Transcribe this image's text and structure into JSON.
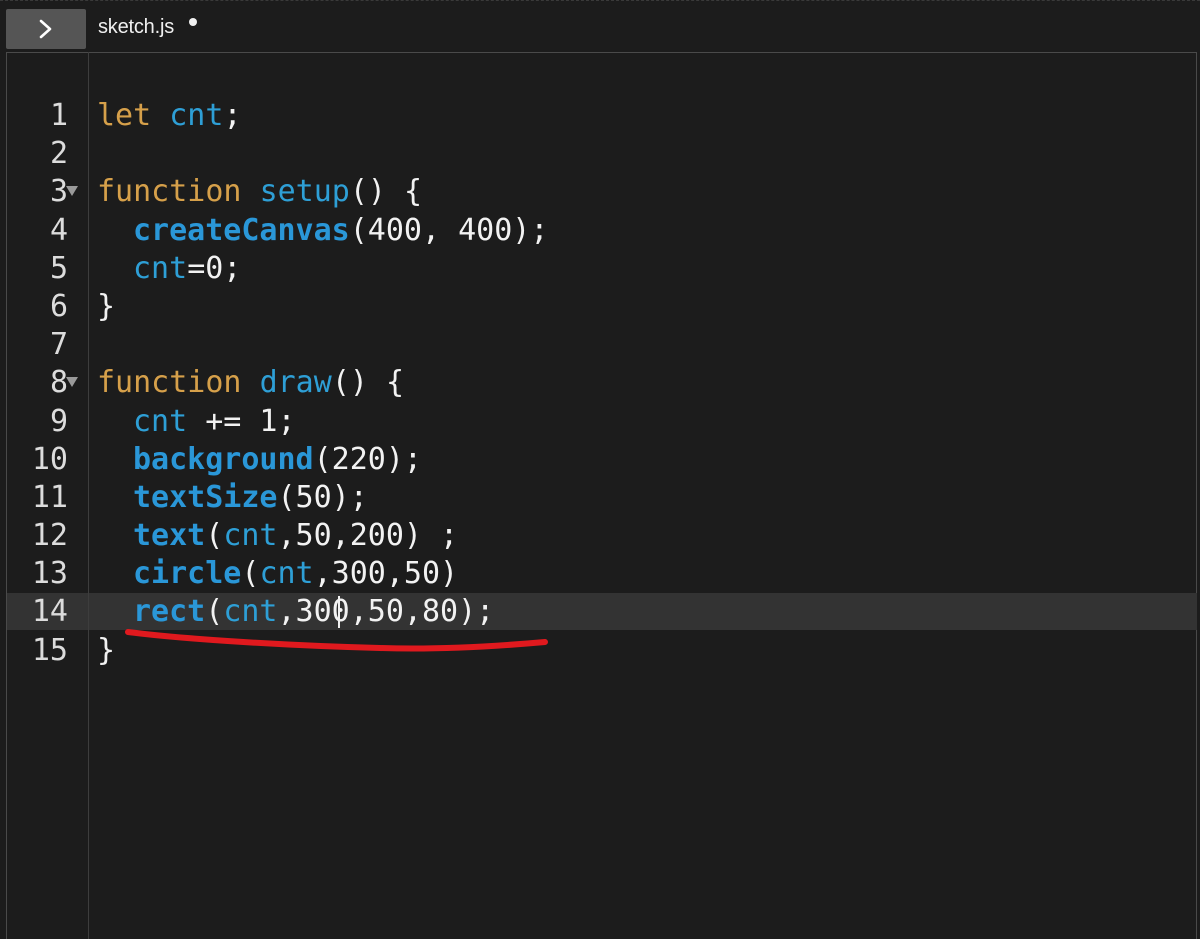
{
  "tab": {
    "filename": "sketch.js",
    "unsaved": true
  },
  "editor": {
    "active_line": 14,
    "lines": [
      {
        "n": "1",
        "fold": false
      },
      {
        "n": "2",
        "fold": false
      },
      {
        "n": "3",
        "fold": true
      },
      {
        "n": "4",
        "fold": false
      },
      {
        "n": "5",
        "fold": false
      },
      {
        "n": "6",
        "fold": false
      },
      {
        "n": "7",
        "fold": false
      },
      {
        "n": "8",
        "fold": true
      },
      {
        "n": "9",
        "fold": false
      },
      {
        "n": "10",
        "fold": false
      },
      {
        "n": "11",
        "fold": false
      },
      {
        "n": "12",
        "fold": false
      },
      {
        "n": "13",
        "fold": false
      },
      {
        "n": "14",
        "fold": false
      },
      {
        "n": "15",
        "fold": false
      }
    ],
    "code": {
      "l1": {
        "kw": "let",
        "var": "cnt",
        "rest": ";"
      },
      "l3": {
        "kw": "function",
        "name": "setup",
        "rest": "() {"
      },
      "l4": {
        "fn": "createCanvas",
        "rest": "(400, 400);"
      },
      "l5": {
        "var": "cnt",
        "rest": "=0;"
      },
      "l6": {
        "rest": "}"
      },
      "l8": {
        "kw": "function",
        "name": "draw",
        "rest": "() {"
      },
      "l9": {
        "var": "cnt",
        "rest": " += 1;"
      },
      "l10": {
        "fn": "background",
        "rest": "(220);"
      },
      "l11": {
        "fn": "textSize",
        "rest": "(50);"
      },
      "l12": {
        "fn": "text",
        "open": "(",
        "var": "cnt",
        "rest": ",50,200) ;"
      },
      "l13": {
        "fn": "circle",
        "open": "(",
        "var": "cnt",
        "rest": ",300,50)"
      },
      "l14": {
        "fn": "rect",
        "open": "(",
        "var": "cnt",
        "rest": ",300,50,80);"
      },
      "l15": {
        "rest": "}"
      }
    }
  },
  "annotation": {
    "underline_color": "#e0191e"
  },
  "icons": {
    "expand": "chevron-right-icon"
  }
}
